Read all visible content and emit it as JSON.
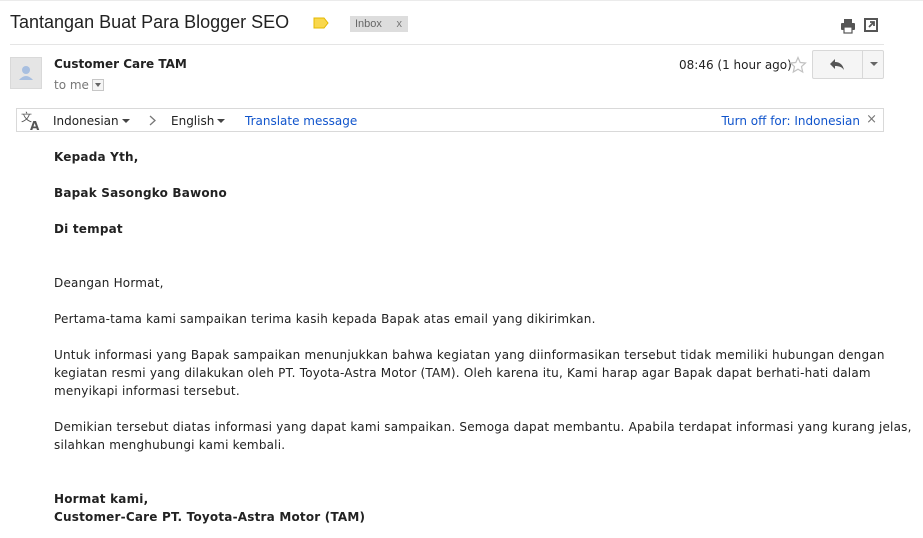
{
  "subject": "Tantangan Buat Para Blogger SEO",
  "labels": {
    "inbox": "Inbox",
    "remove": "x"
  },
  "colors": {
    "label_tag": "#f9d74c",
    "link": "#1155cc"
  },
  "icons": [
    "label-tag-icon",
    "print-icon",
    "new-window-icon",
    "avatar-icon",
    "star-icon",
    "reply-icon",
    "translate-icon"
  ],
  "sender": {
    "name": "Customer Care TAM",
    "to": "to me",
    "time": "08:46 (1 hour ago)"
  },
  "translate": {
    "from": "Indonesian",
    "to": "English",
    "action": "Translate message",
    "turn_off": "Turn off for: Indonesian",
    "close": "×"
  },
  "body": {
    "l1": "Kepada Yth,",
    "l2": "Bapak Sasongko Bawono",
    "l3": "Di tempat",
    "l4": "Deangan Hormat,",
    "l5": "Pertama-tama kami sampaikan terima kasih kepada Bapak atas email yang dikirimkan.",
    "l6": "Untuk informasi yang Bapak sampaikan menunjukkan bahwa kegiatan yang diinformasikan tersebut tidak memiliki hubungan dengan",
    "l7": "kegiatan resmi yang dilakukan oleh PT. Toyota-Astra Motor (TAM). Oleh karena itu, Kami harap agar Bapak dapat berhati-hati dalam",
    "l8": "menyikapi informasi tersebut.",
    "l9": "Demikian tersebut diatas informasi yang dapat kami sampaikan. Semoga dapat membantu. Apabila terdapat informasi yang kurang jelas,",
    "l10": "silahkan menghubungi kami kembali.",
    "l11": "Hormat kami,",
    "l12": "Customer-Care PT. Toyota-Astra Motor (TAM)"
  }
}
